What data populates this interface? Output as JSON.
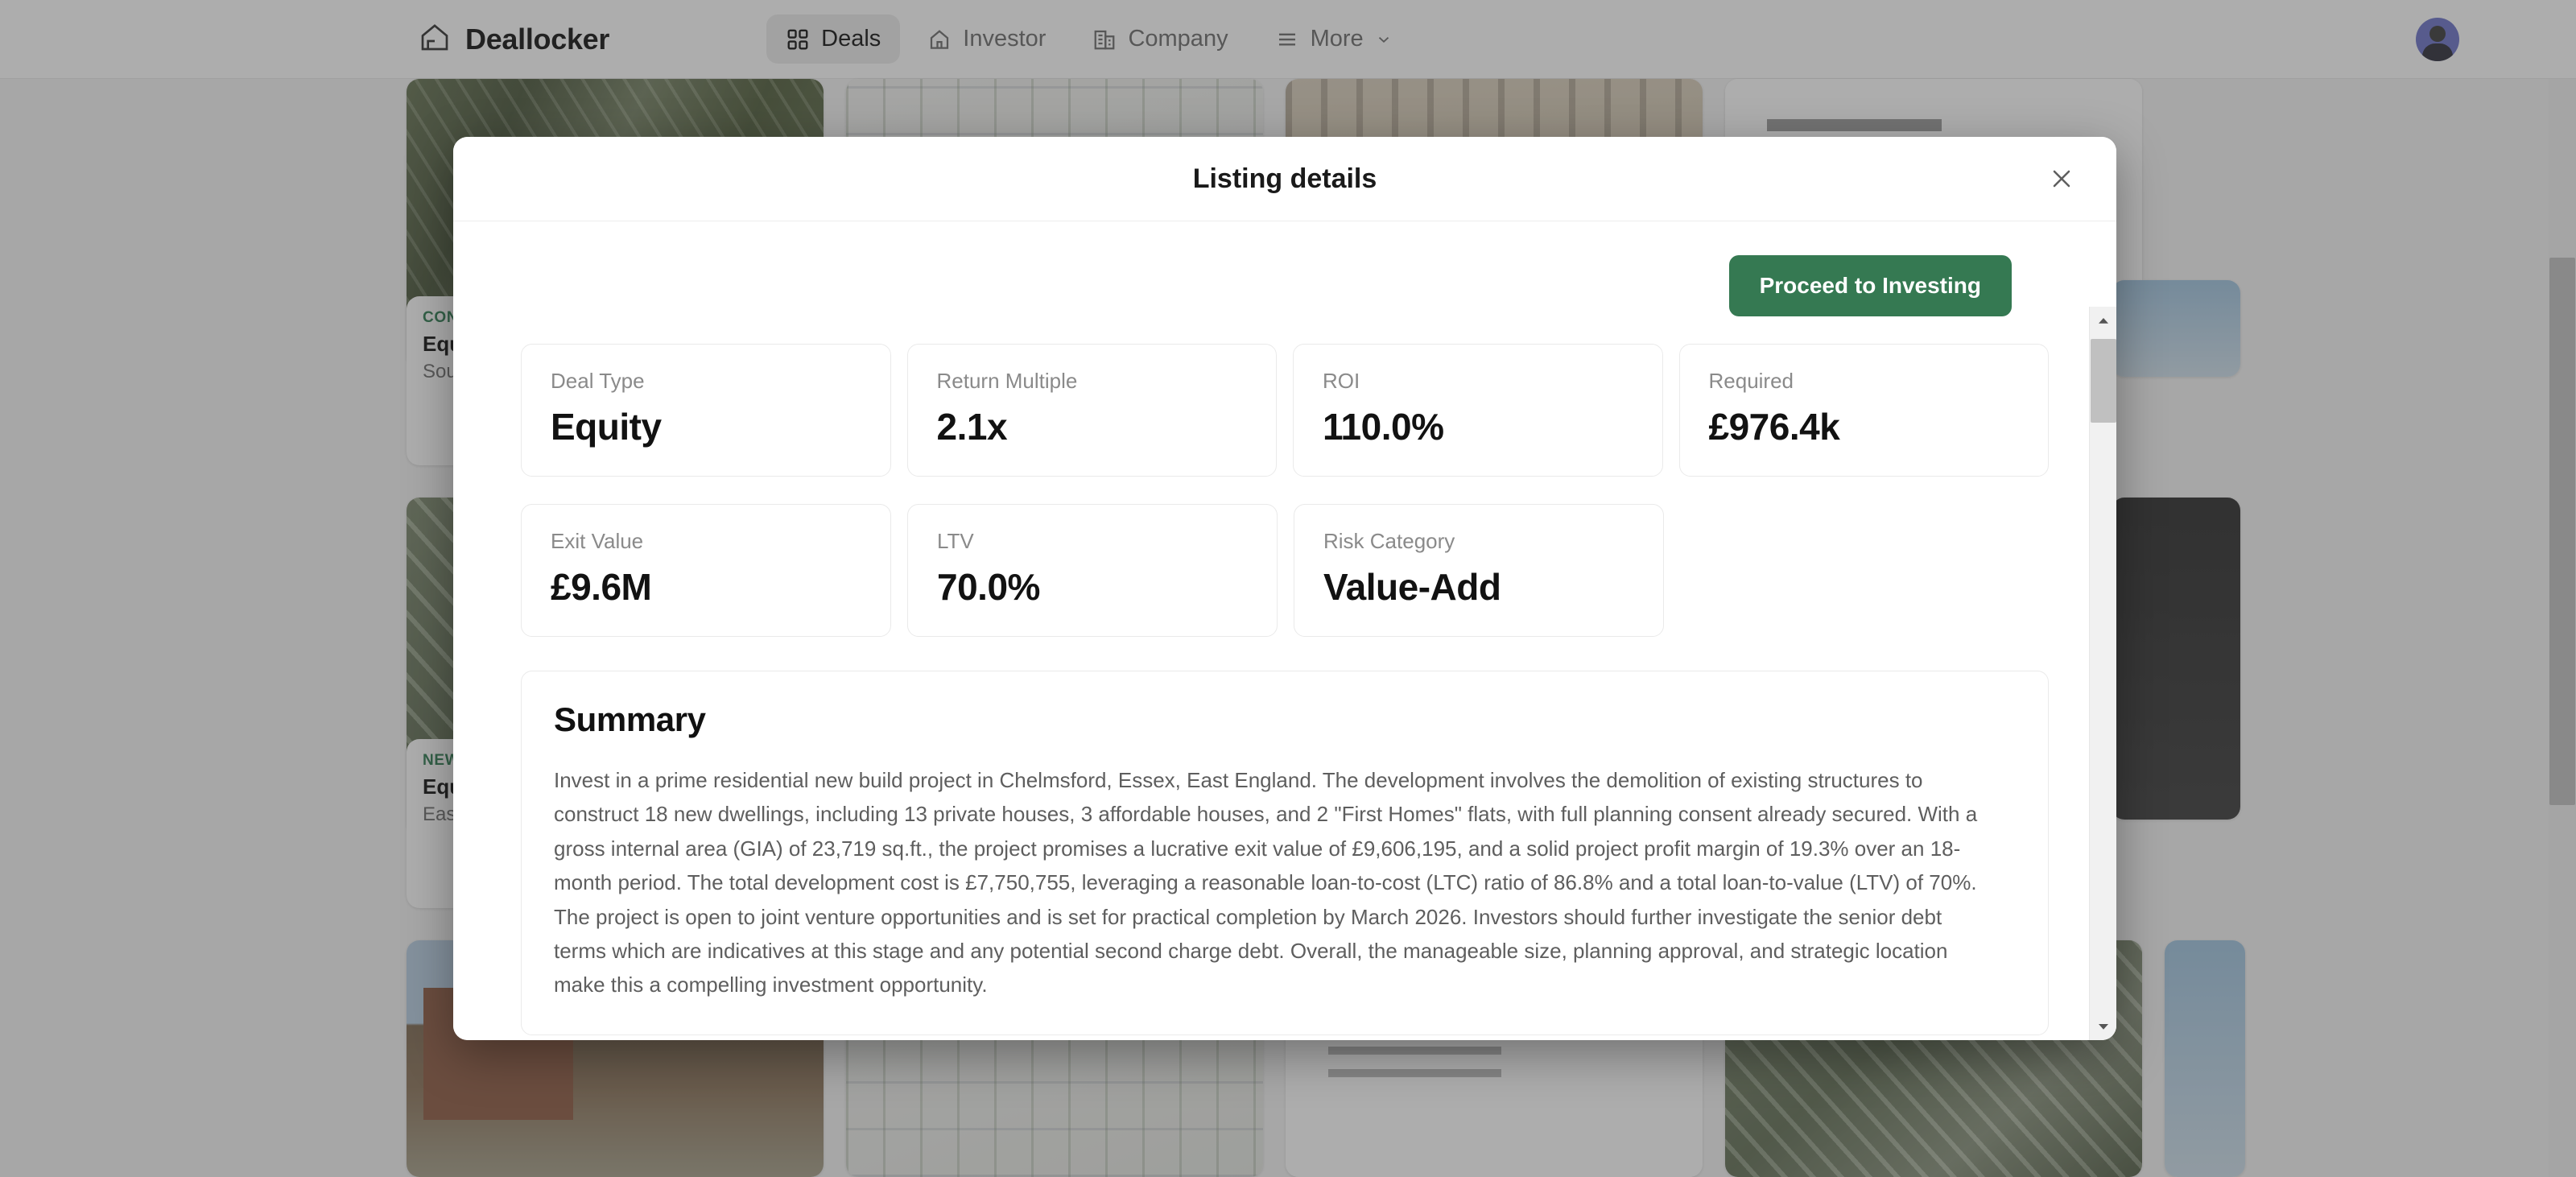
{
  "topbar": {
    "brand": "Deallocker",
    "logo_icon": "house-outline-icon",
    "nav": [
      {
        "label": "Deals",
        "icon": "grid-icon",
        "active": true
      },
      {
        "label": "Investor",
        "icon": "house-icon",
        "active": false
      },
      {
        "label": "Company",
        "icon": "building-icon",
        "active": false
      },
      {
        "label": "More",
        "icon": "hamburger-icon",
        "active": false,
        "chevron": "chevron-down-icon"
      }
    ],
    "avatar": "user-avatar"
  },
  "background_cards": [
    {
      "tag": "CON",
      "title": "Equ",
      "subtitle": "Sou"
    },
    {
      "tag": "NEW",
      "title": "Equ",
      "subtitle": "Eas"
    }
  ],
  "modal": {
    "title": "Listing details",
    "close_icon": "close-icon",
    "cta": {
      "label": "Proceed to Investing",
      "color": "#357952"
    },
    "metrics_row_1": [
      {
        "label": "Deal Type",
        "value": "Equity"
      },
      {
        "label": "Return Multiple",
        "value": "2.1x"
      },
      {
        "label": "ROI",
        "value": "110.0%"
      },
      {
        "label": "Required",
        "value": "£976.4k"
      }
    ],
    "metrics_row_2": [
      {
        "label": "Exit Value",
        "value": "£9.6M"
      },
      {
        "label": "LTV",
        "value": "70.0%"
      },
      {
        "label": "Risk Category",
        "value": "Value-Add"
      }
    ],
    "summary": {
      "title": "Summary",
      "text": "Invest in a prime residential new build project in Chelmsford, Essex, East England. The development involves the demolition of existing structures to construct 18 new dwellings, including 13 private houses, 3 affordable houses, and 2 \"First Homes\" flats, with full planning consent already secured. With a gross internal area (GIA) of 23,719 sq.ft., the project promises a lucrative exit value of £9,606,195, and a solid project profit margin of 19.3% over an 18-month period. The total development cost is £7,750,755, leveraging a reasonable loan-to-cost (LTC) ratio of 86.8% and a total loan-to-value (LTV) of 70%. The project is open to joint venture opportunities and is set for practical completion by March 2026. Investors should further investigate the senior debt terms which are indicatives at this stage and any potential second charge debt. Overall, the manageable size, planning approval, and strategic location make this a compelling investment opportunity."
    },
    "scrollbar": {
      "up_icon": "scroll-up-icon",
      "down_icon": "scroll-down-icon"
    }
  }
}
